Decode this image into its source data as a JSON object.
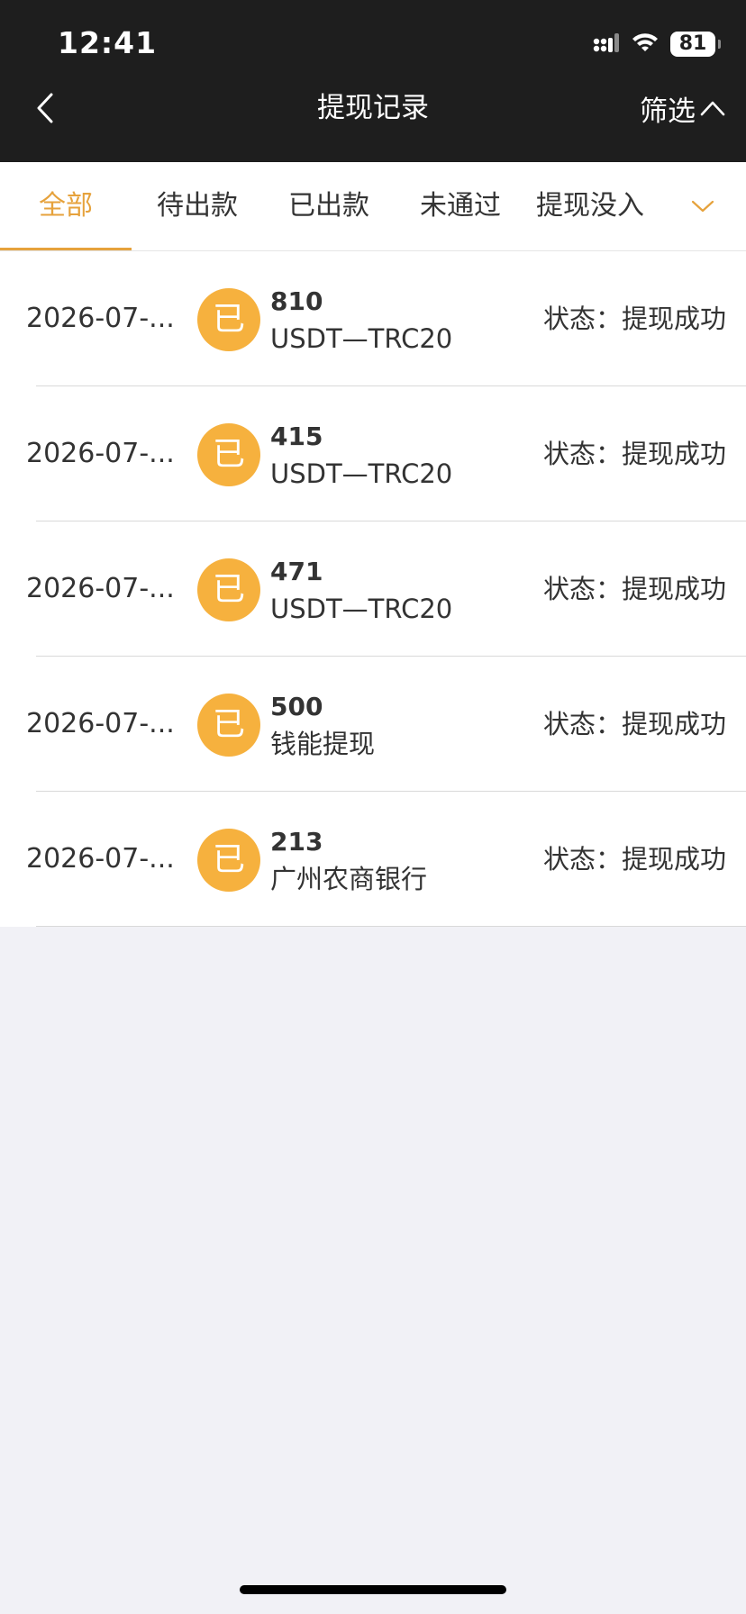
{
  "status_bar": {
    "time": "12:41",
    "battery": "81"
  },
  "header": {
    "title": "提现记录",
    "filter_label": "筛选"
  },
  "tabs": [
    {
      "label": "全部",
      "active": true
    },
    {
      "label": "待出款",
      "active": false
    },
    {
      "label": "已出款",
      "active": false
    },
    {
      "label": "未通过",
      "active": false
    },
    {
      "label": "提现没入",
      "active": false
    }
  ],
  "records": [
    {
      "date": "2026-07-...",
      "badge": "已",
      "amount": "810",
      "method": "USDT—TRC20",
      "status": "状态：提现成功"
    },
    {
      "date": "2026-07-...",
      "badge": "已",
      "amount": "415",
      "method": "USDT—TRC20",
      "status": "状态：提现成功"
    },
    {
      "date": "2026-07-...",
      "badge": "已",
      "amount": "471",
      "method": "USDT—TRC20",
      "status": "状态：提现成功"
    },
    {
      "date": "2026-07-...",
      "badge": "已",
      "amount": "500",
      "method": "钱能提现",
      "status": "状态：提现成功"
    },
    {
      "date": "2026-07-...",
      "badge": "已",
      "amount": "213",
      "method": "广州农商银行",
      "status": "状态：提现成功"
    }
  ],
  "colors": {
    "accent": "#e6a23c",
    "badge": "#f6b13e",
    "header_bg": "#1e1e1e",
    "page_bg": "#f1f1f6"
  }
}
